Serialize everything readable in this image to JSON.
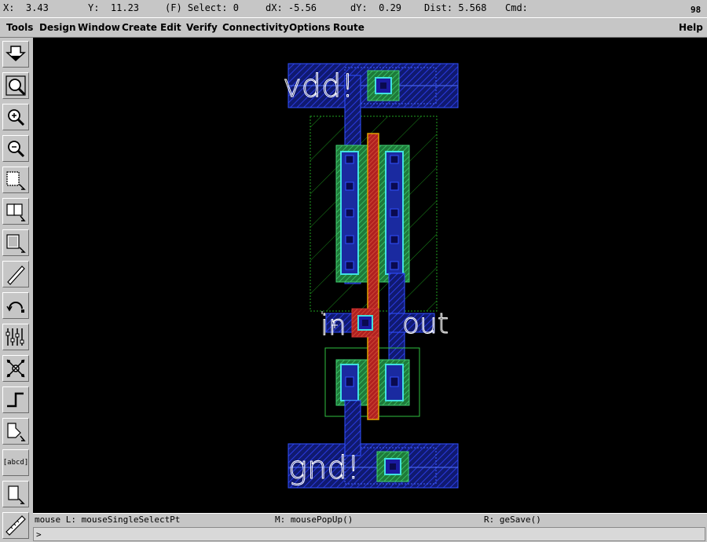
{
  "status": {
    "x": "X:  3.43",
    "y": "Y:  11.23",
    "select": "(F) Select: 0",
    "dx": "dX: -5.56",
    "dy": "dY:  0.29",
    "dist": "Dist: 5.568",
    "cmd": "Cmd:",
    "window_num": "98"
  },
  "menu": {
    "items": [
      "Tools",
      "Design",
      "Window",
      "Create",
      "Edit",
      "Verify",
      "Connectivity",
      "Options",
      "Route"
    ],
    "help": "Help"
  },
  "toolbar": {
    "tools": [
      "save-icon",
      "zoom-fit-icon",
      "zoom-in-icon",
      "zoom-out-icon",
      "stretch-icon",
      "copy-icon",
      "move-icon",
      "path-icon",
      "undo-icon",
      "property-icon",
      "hierarchy-icon",
      "wire-icon",
      "polygon-icon",
      "label-icon",
      "select-icon",
      "ruler-icon"
    ],
    "label_tool_text": "[abcd]"
  },
  "layout": {
    "labels": {
      "vdd": "vdd!",
      "gnd": "gnd!",
      "in": "in",
      "out": "out"
    },
    "colors": {
      "metal1": "#2030e0",
      "poly": "#d03030",
      "diffusion": "#30c060",
      "contact": "#1a1aa0",
      "nwell": "#20a020",
      "active_outline": "#00c0c0",
      "gate_outline": "#e0a000",
      "label": "#ffffff"
    }
  },
  "mouse": {
    "left": "mouse L: mouseSingleSelectPt",
    "middle": "M: mousePopUp()",
    "right": "R: geSave()"
  },
  "cmdline": {
    "prompt": ">"
  }
}
